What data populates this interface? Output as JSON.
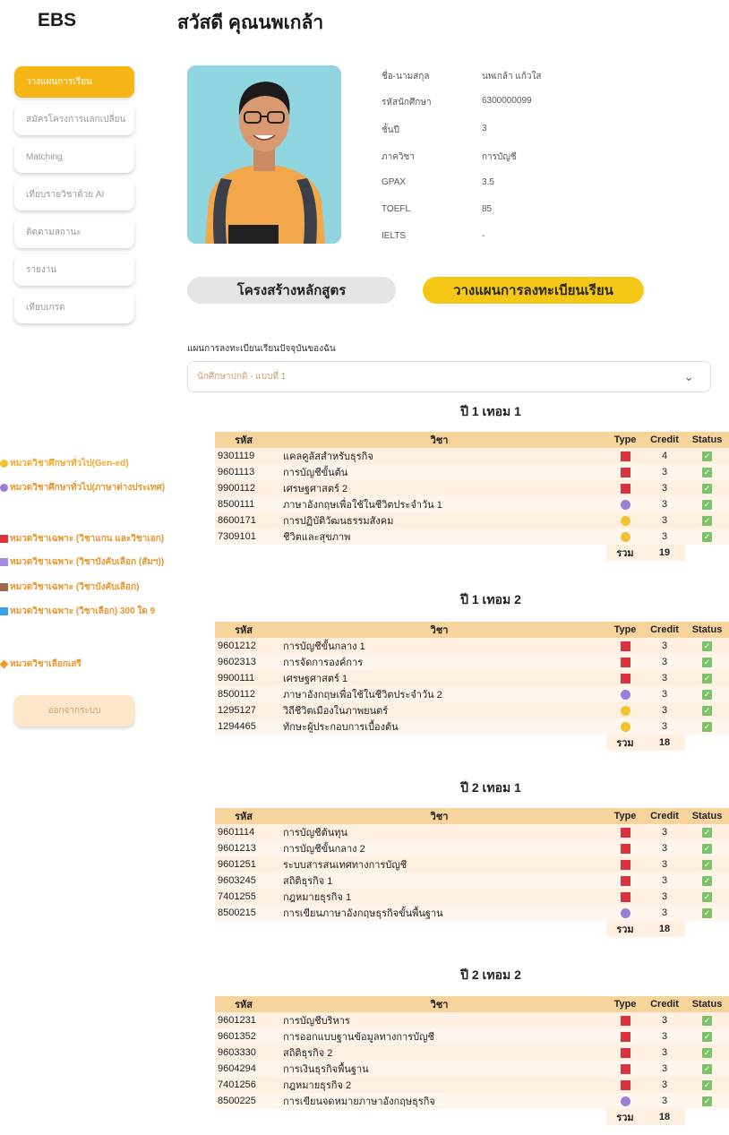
{
  "app": {
    "logo": "EBS",
    "greeting": "สวัสดี คุณนพเกล้า"
  },
  "sidebar": {
    "items": [
      {
        "label": "วางแผนการเรียน",
        "active": true
      },
      {
        "label": "สมัครโครงการแลกเปลี่ยน",
        "active": false
      },
      {
        "label": "Matching",
        "active": false
      },
      {
        "label": "เทียบรายวิชาด้วย AI",
        "active": false
      },
      {
        "label": "ติดตามสถานะ",
        "active": false
      },
      {
        "label": "รายงาน",
        "active": false
      },
      {
        "label": "เทียบเกรด",
        "active": false
      }
    ],
    "logout_label": "ออกจากระบบ",
    "legend": [
      {
        "label": "หมวดวิชาศึกษาทั่วไป(Gen-ed)",
        "color": "#f2c230",
        "shape": "circle"
      },
      {
        "label": "หมวดวิชาศึกษาทั่วไป(ภาษาต่างประเทศ)",
        "color": "#9b7fd4",
        "shape": "circle"
      },
      {
        "label": "หมวดวิชาเฉพาะ (วิชาแกน และวิชาเอก)",
        "color": "#d9333f",
        "shape": "square"
      },
      {
        "label": "หมวดวิชาเฉพาะ (วิชาบังคับเลือก (สัมฯ))",
        "color": "#a98be0",
        "shape": "square"
      },
      {
        "label": "หมวดวิชาเฉพาะ (วิชาบังคับเลือก)",
        "color": "#a0674a",
        "shape": "square"
      },
      {
        "label": "หมวดวิชาเฉพาะ (วิชาเลือก) 300 ใด 9",
        "color": "#3aa0e8",
        "shape": "square"
      },
      {
        "label": "หมวดวิชาเลือกเสรี",
        "color": "#f59a2a",
        "shape": "diamond"
      }
    ]
  },
  "profile": {
    "fields": [
      {
        "label": "ชื่อ-นามสกุล",
        "value": "นพเกล้า แก้วใส"
      },
      {
        "label": "รหัสนักศึกษา",
        "value": "6300000099"
      },
      {
        "label": "ชั้นปี",
        "value": "3"
      },
      {
        "label": "ภาควิชา",
        "value": "การบัญชี"
      },
      {
        "label": "GPAX",
        "value": "3.5"
      },
      {
        "label": "TOEFL",
        "value": "85"
      },
      {
        "label": "IELTS",
        "value": "-"
      }
    ]
  },
  "actions": {
    "curriculum_label": "โครงสร้างหลักสูตร",
    "plan_label": "วางแผนการลงทะเบียนเรียน"
  },
  "plan": {
    "title": "แผนการลงทะเบียนเรียนปัจจุบันของฉัน",
    "selected": "นักศึกษาปกติ - แบบที่ 1"
  },
  "table_headers": {
    "code": "รหัส",
    "name": "วิชา",
    "type": "Type",
    "credit": "Credit",
    "status": "Status",
    "sum": "รวม"
  },
  "terms": [
    {
      "title": "ปี 1 เทอม 1",
      "total": "19",
      "courses": [
        {
          "code": "9301119",
          "name": "แคลคูลัสสำหรับธุรกิจ",
          "type": "square",
          "type_color": "#d9333f",
          "credit": "4",
          "status": "✓"
        },
        {
          "code": "9601113",
          "name": "การบัญชีขั้นต้น",
          "type": "square",
          "type_color": "#d9333f",
          "credit": "3",
          "status": "✓"
        },
        {
          "code": "9900112",
          "name": "เศรษฐศาสตร์ 2",
          "type": "square",
          "type_color": "#d9333f",
          "credit": "3",
          "status": "✓"
        },
        {
          "code": "8500111",
          "name": "ภาษาอังกฤษเพื่อใช้ในชีวิตประจำวัน 1",
          "type": "circle",
          "type_color": "#9b7fd4",
          "credit": "3",
          "status": "✓"
        },
        {
          "code": "8600171",
          "name": "การปฏิบัติวัฒนธรรมสังคม",
          "type": "circle",
          "type_color": "#f2c230",
          "credit": "3",
          "status": "✓"
        },
        {
          "code": "7309101",
          "name": "ชีวิตและสุขภาพ",
          "type": "circle",
          "type_color": "#f2c230",
          "credit": "3",
          "status": "✓"
        }
      ]
    },
    {
      "title": "ปี 1 เทอม 2",
      "total": "18",
      "courses": [
        {
          "code": "9601212",
          "name": "การบัญชีขั้นกลาง 1",
          "type": "square",
          "type_color": "#d9333f",
          "credit": "3",
          "status": "✓"
        },
        {
          "code": "9602313",
          "name": "การจัดการองค์การ",
          "type": "square",
          "type_color": "#d9333f",
          "credit": "3",
          "status": "✓"
        },
        {
          "code": "9900111",
          "name": "เศรษฐศาสตร์ 1",
          "type": "square",
          "type_color": "#d9333f",
          "credit": "3",
          "status": "✓"
        },
        {
          "code": "8500112",
          "name": "ภาษาอังกฤษเพื่อใช้ในชีวิตประจำวัน 2",
          "type": "circle",
          "type_color": "#9b7fd4",
          "credit": "3",
          "status": "✓"
        },
        {
          "code": "1295127",
          "name": "วิถีชีวิตเมืองในภาพยนตร์",
          "type": "circle",
          "type_color": "#f2c230",
          "credit": "3",
          "status": "✓"
        },
        {
          "code": "1294465",
          "name": "ทักษะผู้ประกอบการเบื้องต้น",
          "type": "circle",
          "type_color": "#f2c230",
          "credit": "3",
          "status": "✓"
        }
      ]
    },
    {
      "title": "ปี 2 เทอม 1",
      "total": "18",
      "courses": [
        {
          "code": "9601114",
          "name": "การบัญชีต้นทุน",
          "type": "square",
          "type_color": "#d9333f",
          "credit": "3",
          "status": "✓"
        },
        {
          "code": "9601213",
          "name": "การบัญชีขั้นกลาง 2",
          "type": "square",
          "type_color": "#d9333f",
          "credit": "3",
          "status": "✓"
        },
        {
          "code": "9601251",
          "name": "ระบบสารสนเทศทางการบัญชี",
          "type": "square",
          "type_color": "#d9333f",
          "credit": "3",
          "status": "✓"
        },
        {
          "code": "9603245",
          "name": "สถิติธุรกิจ 1",
          "type": "square",
          "type_color": "#d9333f",
          "credit": "3",
          "status": "✓"
        },
        {
          "code": "7401255",
          "name": "กฎหมายธุรกิจ 1",
          "type": "square",
          "type_color": "#d9333f",
          "credit": "3",
          "status": "✓"
        },
        {
          "code": "8500215",
          "name": "การเขียนภาษาอังกฤษธุรกิจขั้นพื้นฐาน",
          "type": "circle",
          "type_color": "#9b7fd4",
          "credit": "3",
          "status": "✓"
        }
      ]
    },
    {
      "title": "ปี 2 เทอม 2",
      "total": "18",
      "courses": [
        {
          "code": "9601231",
          "name": "การบัญชีบริหาร",
          "type": "square",
          "type_color": "#d9333f",
          "credit": "3",
          "status": "✓"
        },
        {
          "code": "9601352",
          "name": "การออกแบบฐานข้อมูลทางการบัญชี",
          "type": "square",
          "type_color": "#d9333f",
          "credit": "3",
          "status": "✓"
        },
        {
          "code": "9603330",
          "name": "สถิติธุรกิจ 2",
          "type": "square",
          "type_color": "#d9333f",
          "credit": "3",
          "status": "✓"
        },
        {
          "code": "9604294",
          "name": "การเงินธุรกิจพื้นฐาน",
          "type": "square",
          "type_color": "#d9333f",
          "credit": "3",
          "status": "✓"
        },
        {
          "code": "7401256",
          "name": "กฎหมายธุรกิจ 2",
          "type": "square",
          "type_color": "#d9333f",
          "credit": "3",
          "status": "✓"
        },
        {
          "code": "8500225",
          "name": "การเขียนจดหมายภาษาอังกฤษธุรกิจ",
          "type": "circle",
          "type_color": "#9b7fd4",
          "credit": "3",
          "status": "✓"
        }
      ]
    }
  ]
}
